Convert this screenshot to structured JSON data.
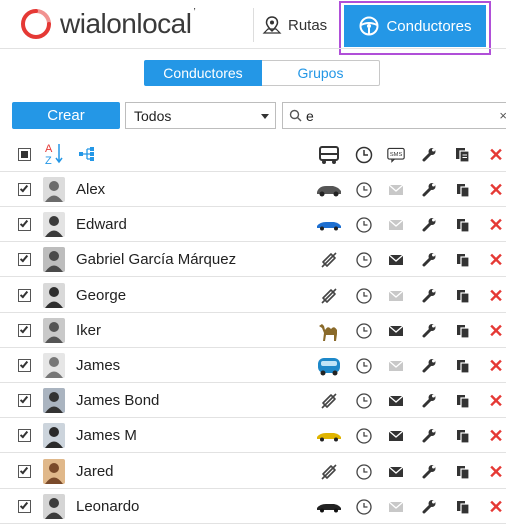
{
  "app": {
    "logo_text_main": "wialon",
    "logo_text_sub": "local",
    "logo_tick": "’",
    "brand_red": "#e53935",
    "accent": "#2497e6"
  },
  "nav": {
    "rutas_label": "Rutas",
    "conductores_label": "Conductores"
  },
  "segment": {
    "conductores": "Conductores",
    "grupos": "Grupos"
  },
  "toolbar": {
    "crear_label": "Crear",
    "filter_value": "Todos",
    "search_value": "e",
    "clear_glyph": "×"
  },
  "header": {
    "sort_az": "A↓Z",
    "delete_glyph": "✕"
  },
  "rows": [
    {
      "name": "Alex",
      "vehicle": "dark-car-icon",
      "mail_active": false
    },
    {
      "name": "Edward",
      "vehicle": "blue-car-icon",
      "mail_active": false
    },
    {
      "name": "Gabriel García Márquez",
      "vehicle": "unbound-icon",
      "mail_active": true
    },
    {
      "name": "George",
      "vehicle": "unbound-icon",
      "mail_active": false
    },
    {
      "name": "Iker",
      "vehicle": "camel-icon",
      "mail_active": true
    },
    {
      "name": "James",
      "vehicle": "blue-van-icon",
      "mail_active": false
    },
    {
      "name": "James Bond",
      "vehicle": "unbound-icon",
      "mail_active": true
    },
    {
      "name": "James M",
      "vehicle": "yellow-car-icon",
      "mail_active": true
    },
    {
      "name": "Jared",
      "vehicle": "unbound-icon",
      "mail_active": true
    },
    {
      "name": "Leonardo",
      "vehicle": "black-car-icon",
      "mail_active": false
    }
  ]
}
